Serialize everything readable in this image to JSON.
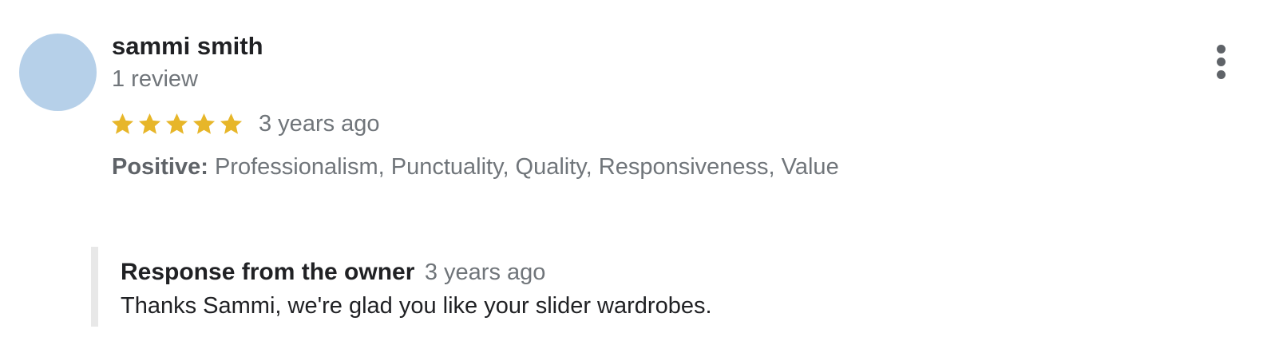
{
  "review": {
    "reviewer_name": "sammi smith",
    "review_count": "1 review",
    "rating": 5,
    "rating_max": 5,
    "date": "3 years ago",
    "attributes_label": "Positive:",
    "attributes_text": "Professionalism, Punctuality, Quality, Responsiveness, Value",
    "menu_icon": "more-vert-icon"
  },
  "owner_response": {
    "title": "Response from the owner",
    "date": "3 years ago",
    "text": "Thanks Sammi, we're glad you like your slider wardrobes."
  },
  "colors": {
    "star": "#e7b629",
    "avatar": "#b6d0e9",
    "secondary_text": "#70757a",
    "primary_text": "#202124"
  }
}
